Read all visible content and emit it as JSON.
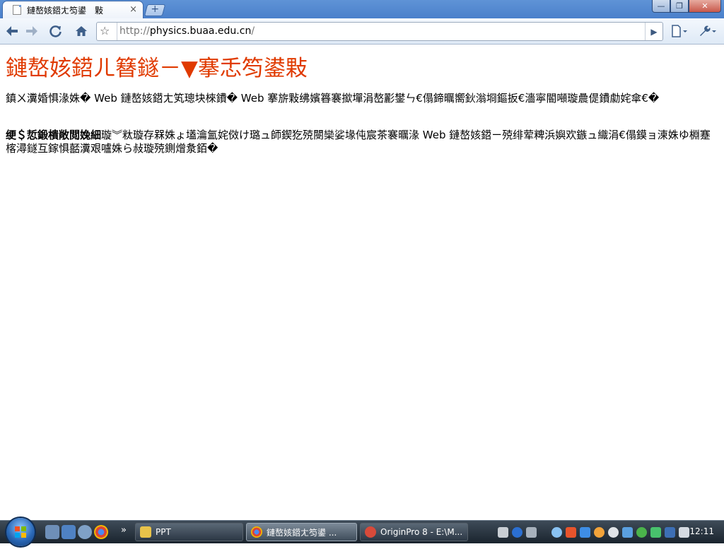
{
  "window": {
    "tab_title": "鏈嶅姟鍣ㄤ笉鍙　敤",
    "tab_close": "×",
    "new_tab": "+",
    "minimize": "—",
    "maximize": "❐",
    "close": "✕"
  },
  "toolbar": {
    "back_icon": "arrow-left",
    "forward_icon": "arrow-right",
    "reload_icon": "reload",
    "home_icon": "home",
    "bookmark_icon": "star",
    "go_icon": "play",
    "page_menu_icon": "page",
    "tools_menu_icon": "wrench",
    "url_scheme": "http://",
    "url_host": "physics.buaa.edu.cn",
    "url_path": "/"
  },
  "page": {
    "heading": "鏈嶅姟鍣ㄦ簮鐩－▼搴忎笉鍙敤",
    "paragraph1": "鎮ㄨ瀵婚惧湪姝� Web 鏈嶅姟鍣ㄤ笂璁块棶鐨� Web 搴旂敤绋嬪簭褰撳墠涓嶅彲鐢ㄣ€傝鍗曞嚮鈥滃埛鏂扳€濇寜閽噸璇曟偍鐨勮姹傘€�",
    "paragraph2_bold": "绠＄悊鍛樻敞閲婏細",
    "paragraph2_rest": "璇︾粏璇存槑姝ょ壒瀹氳姹傚け璐ュ師鍥犵殑閿欒娑堟伅宸茶褰曞湪 Web 鏈嶅姟鍣ㄧ殑绯荤粺浜嬩欢鏃ュ織涓€傝鏌ョ湅姝ゆ棩蹇楁潯鐩互鎵惧嚭瀵艰嚧姝ら敊璇殑鍘熷洜銆�"
  },
  "taskbar": {
    "items": [
      {
        "label": "PPT",
        "active": false
      },
      {
        "label": "鏈嶅姟鍣ㄤ笉鍙   ...",
        "active": true
      },
      {
        "label": "OriginPro 8 - E:\\M...",
        "active": false
      }
    ],
    "clock": "12:11",
    "show_more": "»"
  },
  "colors": {
    "heading": "#e03a00",
    "titlebar": "#4a80cb",
    "taskbar": "#1a242e"
  }
}
